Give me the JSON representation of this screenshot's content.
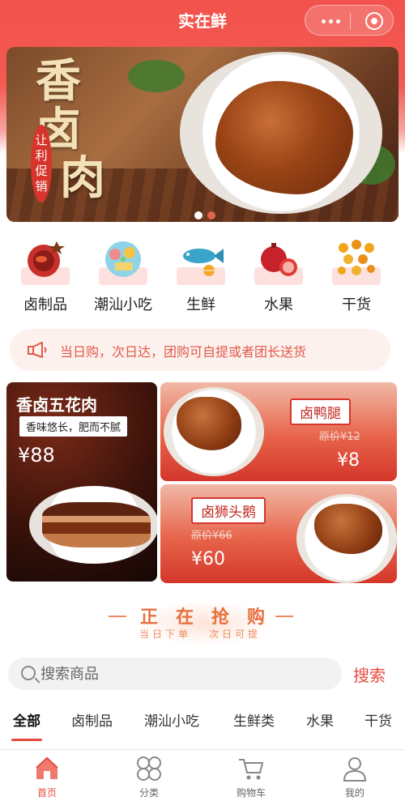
{
  "nav": {
    "title": "实在鲜"
  },
  "banner": {
    "title_line1": "香卤",
    "title_line2": "肉",
    "promo": "让利促销",
    "slide_count": 2,
    "active_slide": 1
  },
  "categories": [
    {
      "label": "卤制品",
      "icon": "braised-bowl-icon"
    },
    {
      "label": "潮汕小吃",
      "icon": "snack-plate-icon"
    },
    {
      "label": "生鲜",
      "icon": "fish-icon"
    },
    {
      "label": "水果",
      "icon": "fruit-icon"
    },
    {
      "label": "干货",
      "icon": "dried-goods-icon"
    }
  ],
  "notice": {
    "text": "当日购，次日达，团购可自提或者团长送货",
    "icon": "megaphone-icon"
  },
  "promos": {
    "big": {
      "name": "香卤五花肉",
      "tag": "香味悠长，肥而不腻",
      "price": "¥88"
    },
    "duck": {
      "name": "卤鸭腿",
      "original": "原价¥12",
      "price": "¥8"
    },
    "goose": {
      "name": "卤狮头鹅",
      "original": "原价¥66",
      "price": "¥60"
    }
  },
  "flash_sale": {
    "title": "正在抢购",
    "sub_left": "当日下单",
    "sub_right": "次日可提"
  },
  "search": {
    "placeholder": "搜索商品",
    "button": "搜索"
  },
  "tabs": [
    "全部",
    "卤制品",
    "潮汕小吃",
    "生鲜类",
    "水果",
    "干货"
  ],
  "tabbar": [
    {
      "label": "首页",
      "icon": "home-icon"
    },
    {
      "label": "分类",
      "icon": "category-icon"
    },
    {
      "label": "购物车",
      "icon": "cart-icon"
    },
    {
      "label": "我的",
      "icon": "user-icon"
    }
  ],
  "colors": {
    "brand": "#f2524c",
    "accent": "#e54b3f",
    "notice_bg": "#fdf1ee"
  }
}
